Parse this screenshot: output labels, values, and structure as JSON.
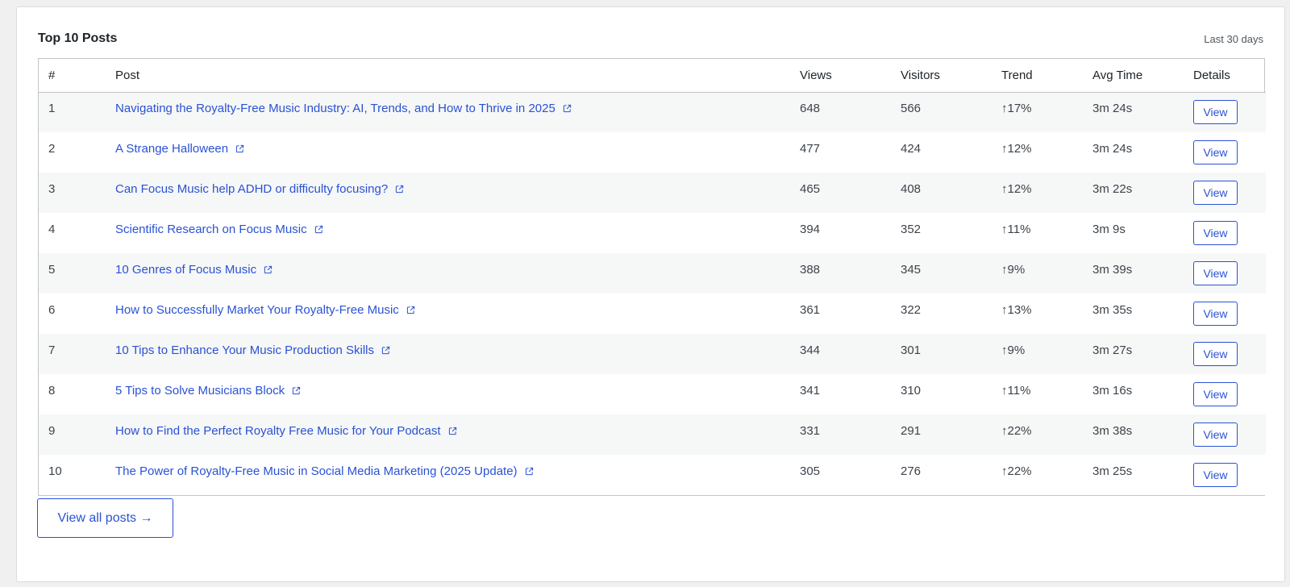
{
  "card": {
    "title": "Top 10 Posts",
    "range": "Last 30 days"
  },
  "table": {
    "headers": [
      "#",
      "Post",
      "Views",
      "Visitors",
      "Trend",
      "Avg Time",
      "Details"
    ],
    "rows": [
      {
        "rank": "1",
        "title": "Navigating the Royalty-Free Music Industry: AI, Trends, and How to Thrive in 2025",
        "views": "648",
        "visitors": "566",
        "trend": "↑17%",
        "avg_time": "3m 24s",
        "action": "View"
      },
      {
        "rank": "2",
        "title": "A Strange Halloween",
        "views": "477",
        "visitors": "424",
        "trend": "↑12%",
        "avg_time": "3m 24s",
        "action": "View"
      },
      {
        "rank": "3",
        "title": "Can Focus Music help ADHD or difficulty focusing?",
        "views": "465",
        "visitors": "408",
        "trend": "↑12%",
        "avg_time": "3m 22s",
        "action": "View"
      },
      {
        "rank": "4",
        "title": "Scientific Research on Focus Music",
        "views": "394",
        "visitors": "352",
        "trend": "↑11%",
        "avg_time": "3m 9s",
        "action": "View"
      },
      {
        "rank": "5",
        "title": "10 Genres of Focus Music",
        "views": "388",
        "visitors": "345",
        "trend": "↑9%",
        "avg_time": "3m 39s",
        "action": "View"
      },
      {
        "rank": "6",
        "title": "How to Successfully Market Your Royalty-Free Music",
        "views": "361",
        "visitors": "322",
        "trend": "↑13%",
        "avg_time": "3m 35s",
        "action": "View"
      },
      {
        "rank": "7",
        "title": "10 Tips to Enhance Your Music Production Skills",
        "views": "344",
        "visitors": "301",
        "trend": "↑9%",
        "avg_time": "3m 27s",
        "action": "View"
      },
      {
        "rank": "8",
        "title": "5 Tips to Solve Musicians Block",
        "views": "341",
        "visitors": "310",
        "trend": "↑11%",
        "avg_time": "3m 16s",
        "action": "View"
      },
      {
        "rank": "9",
        "title": "How to Find the Perfect Royalty Free Music for Your Podcast",
        "views": "331",
        "visitors": "291",
        "trend": "↑22%",
        "avg_time": "3m 38s",
        "action": "View"
      },
      {
        "rank": "10",
        "title": "The Power of Royalty-Free Music in Social Media Marketing (2025 Update)",
        "views": "305",
        "visitors": "276",
        "trend": "↑22%",
        "avg_time": "3m 25s",
        "action": "View"
      }
    ]
  },
  "footer": {
    "view_all_label": "View all posts →"
  },
  "icons": {
    "external_link": "external-link-icon"
  },
  "colors": {
    "link": "#2a52d4",
    "row_stripe": "#f6f7f7",
    "border": "#c3c4c7"
  }
}
